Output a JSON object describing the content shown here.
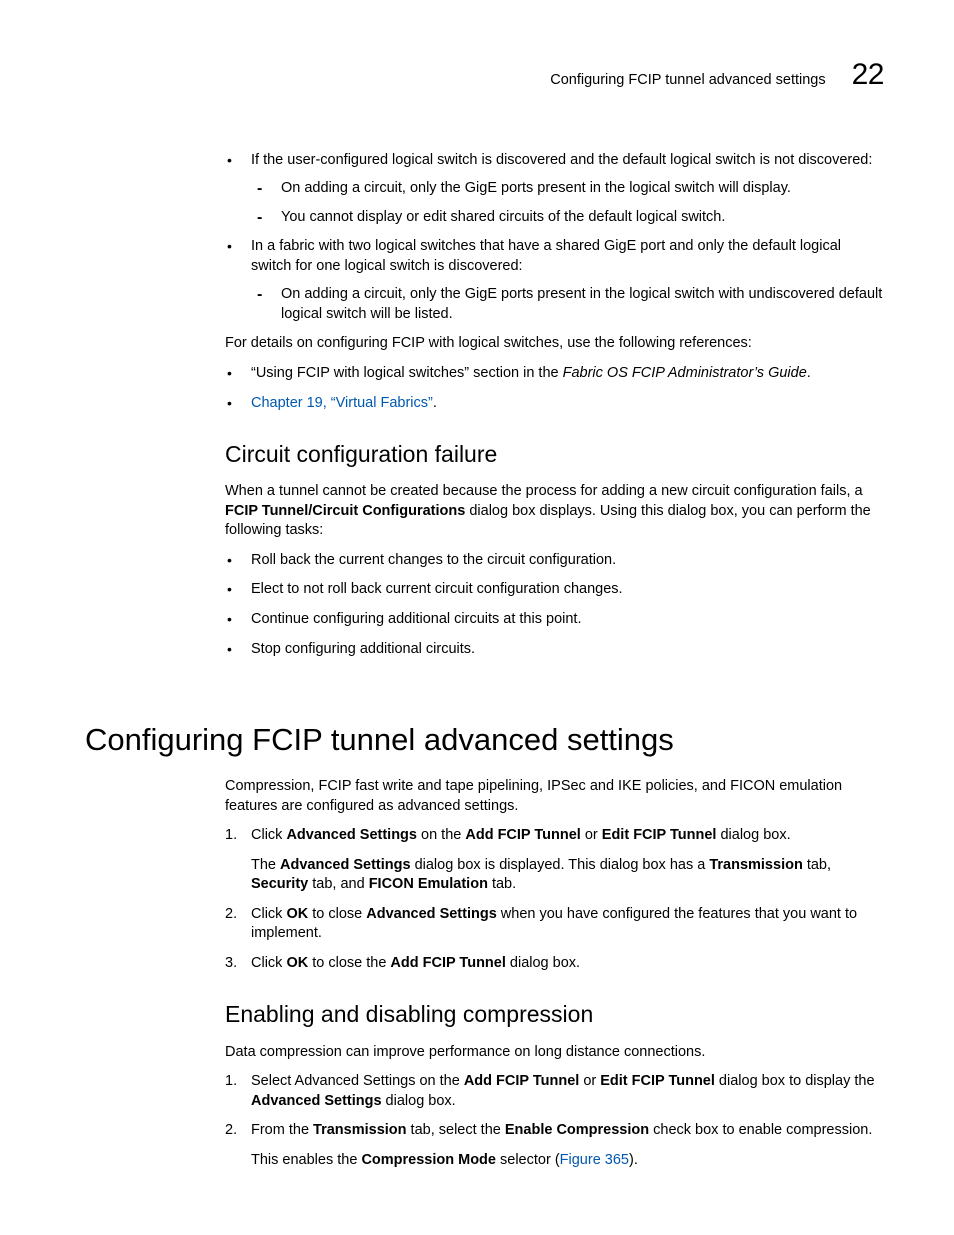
{
  "header": {
    "title": "Configuring FCIP tunnel advanced settings",
    "chapter_number": "22"
  },
  "section_a": {
    "bullets": [
      {
        "text": "If the user-configured logical switch is discovered and the default logical switch is not discovered:",
        "sub": [
          "On adding a circuit, only the GigE ports present in the logical switch will display.",
          "You cannot display or edit shared circuits of the default logical switch."
        ]
      },
      {
        "text": "In a fabric with two logical switches that have a shared GigE port and only the default logical switch for one logical switch is discovered:",
        "sub": [
          "On adding a circuit, only the GigE ports present in the logical switch with undiscovered default logical switch will be listed."
        ]
      }
    ],
    "refs_intro": "For details on configuring FCIP with logical switches, use the following references:",
    "refs": {
      "ref1_pre": "“Using FCIP with logical switches” section in the ",
      "ref1_ital": "Fabric OS FCIP Administrator’s Guide",
      "ref1_post": ".",
      "ref2_link": "Chapter 19, “Virtual Fabrics”",
      "ref2_post": "."
    }
  },
  "section_b": {
    "heading": "Circuit configuration failure",
    "intro_pre": "When a tunnel cannot be created because the process for adding a new circuit configuration fails, a ",
    "intro_bold": "FCIP Tunnel/Circuit Configurations",
    "intro_post": " dialog box displays. Using this dialog box, you can perform the following tasks:",
    "bullets": [
      "Roll back the current changes to the circuit configuration.",
      "Elect to not roll back current circuit configuration changes.",
      "Continue configuring additional circuits at this point.",
      "Stop configuring additional circuits."
    ]
  },
  "section_c": {
    "heading": "Configuring FCIP tunnel advanced settings",
    "intro": "Compression, FCIP fast write and tape pipelining, IPSec and IKE policies, and FICON emulation features are configured as advanced settings.",
    "steps": {
      "s1": {
        "num": "1.",
        "t1": "Click ",
        "b1": "Advanced Settings",
        "t2": " on the ",
        "b2": "Add FCIP Tunnel",
        "t3": " or ",
        "b3": "Edit FCIP Tunnel",
        "t4": " dialog box.",
        "n_t1": "The ",
        "n_b1": "Advanced Settings",
        "n_t2": " dialog box is displayed. This dialog box has a ",
        "n_b2": "Transmission",
        "n_t3": " tab, ",
        "n_b3": "Security",
        "n_t4": " tab, and ",
        "n_b4": "FICON Emulation",
        "n_t5": " tab."
      },
      "s2": {
        "num": "2.",
        "t1": "Click ",
        "b1": "OK",
        "t2": " to close ",
        "b2": "Advanced Settings",
        "t3": " when you have configured the features that you want to implement."
      },
      "s3": {
        "num": "3.",
        "t1": "Click ",
        "b1": "OK",
        "t2": " to close the ",
        "b2": "Add FCIP Tunnel",
        "t3": " dialog box."
      }
    }
  },
  "section_d": {
    "heading": "Enabling and disabling compression",
    "intro": "Data compression can improve performance on long distance connections.",
    "steps": {
      "s1": {
        "num": "1.",
        "t1": "Select Advanced Settings on the ",
        "b1": "Add FCIP Tunnel",
        "t2": " or ",
        "b2": "Edit FCIP Tunnel",
        "t3": " dialog box to display the ",
        "b3": "Advanced Settings",
        "t4": " dialog box."
      },
      "s2": {
        "num": "2.",
        "t1": "From the ",
        "b1": "Transmission",
        "t2": " tab, select the ",
        "b2": "Enable Compression",
        "t3": " check box to enable compression.",
        "n_t1": "This enables the ",
        "n_b1": "Compression Mode",
        "n_t2": " selector (",
        "n_link": "Figure 365",
        "n_t3": ")."
      }
    }
  }
}
